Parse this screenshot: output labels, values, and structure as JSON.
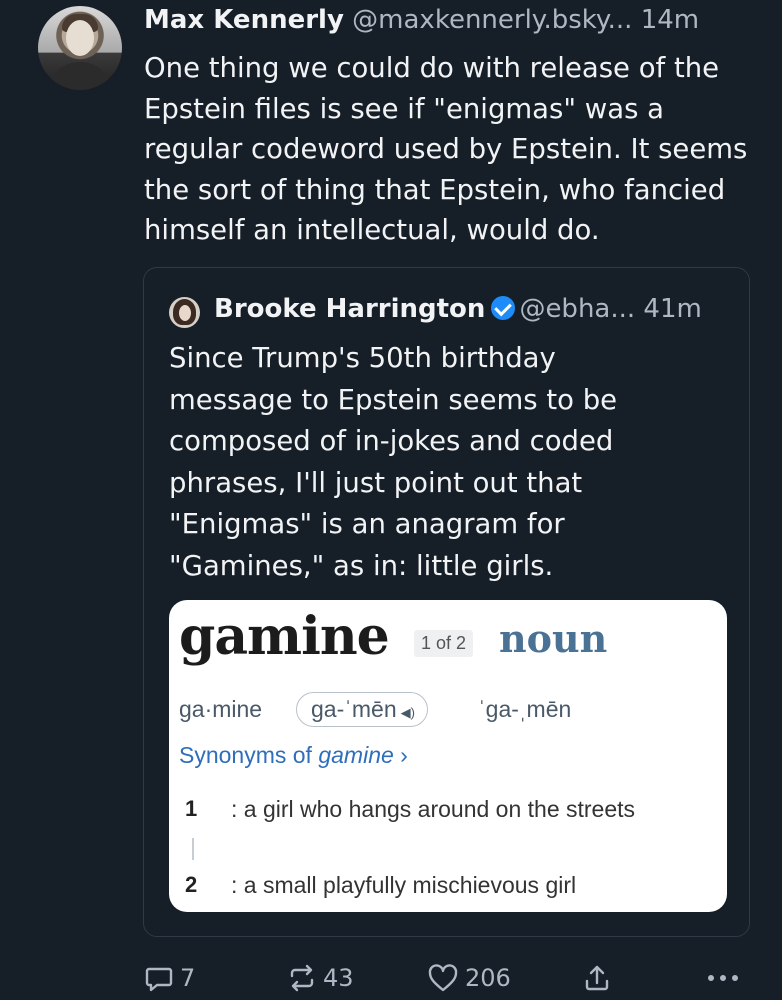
{
  "post": {
    "author_name": "Max Kennerly",
    "handle": "@maxkennerly.bsky...",
    "time": "14m",
    "text": "One thing we could do with release of the Epstein files is see if \"enigmas\" was a regular codeword used by Epstein. It seems the sort of thing that Epstein, who fancied himself an intellectual, would do."
  },
  "quote": {
    "author_name": "Brooke Harrington",
    "handle": "@ebha...",
    "time": "41m",
    "verified": true,
    "text": "Since Trump's 50th birthday message to Epstein seems to be composed of in-jokes and coded phrases, I'll just point out that \"Enigmas\" is an anagram for \"Gamines,\" as in: little girls."
  },
  "dictionary": {
    "headword": "gamine",
    "entry_count": "1 of 2",
    "part_of_speech": "noun",
    "syllabification": "ga·mine",
    "pronunciation_1": "ga-ˈmēn",
    "pronunciation_2": "ˈga-ˌmēn",
    "synonyms_prefix": "Synonyms of ",
    "synonyms_word": "gamine",
    "synonyms_suffix": " ›",
    "definitions": [
      {
        "num": "1",
        "text": ": a girl who hangs around on the streets"
      },
      {
        "num": "2",
        "text": ": a small playfully mischievous girl"
      }
    ]
  },
  "actions": {
    "replies": "7",
    "reposts": "43",
    "likes": "206"
  },
  "icons": [
    "reply-icon",
    "repost-icon",
    "like-icon",
    "share-icon",
    "more-icon",
    "speaker-icon",
    "verified-icon"
  ],
  "colors": {
    "background": "#161e27",
    "text": "#f1f3f5",
    "muted": "#aeb8c4",
    "verified": "#1d8cf8",
    "link": "#2f6eba"
  }
}
